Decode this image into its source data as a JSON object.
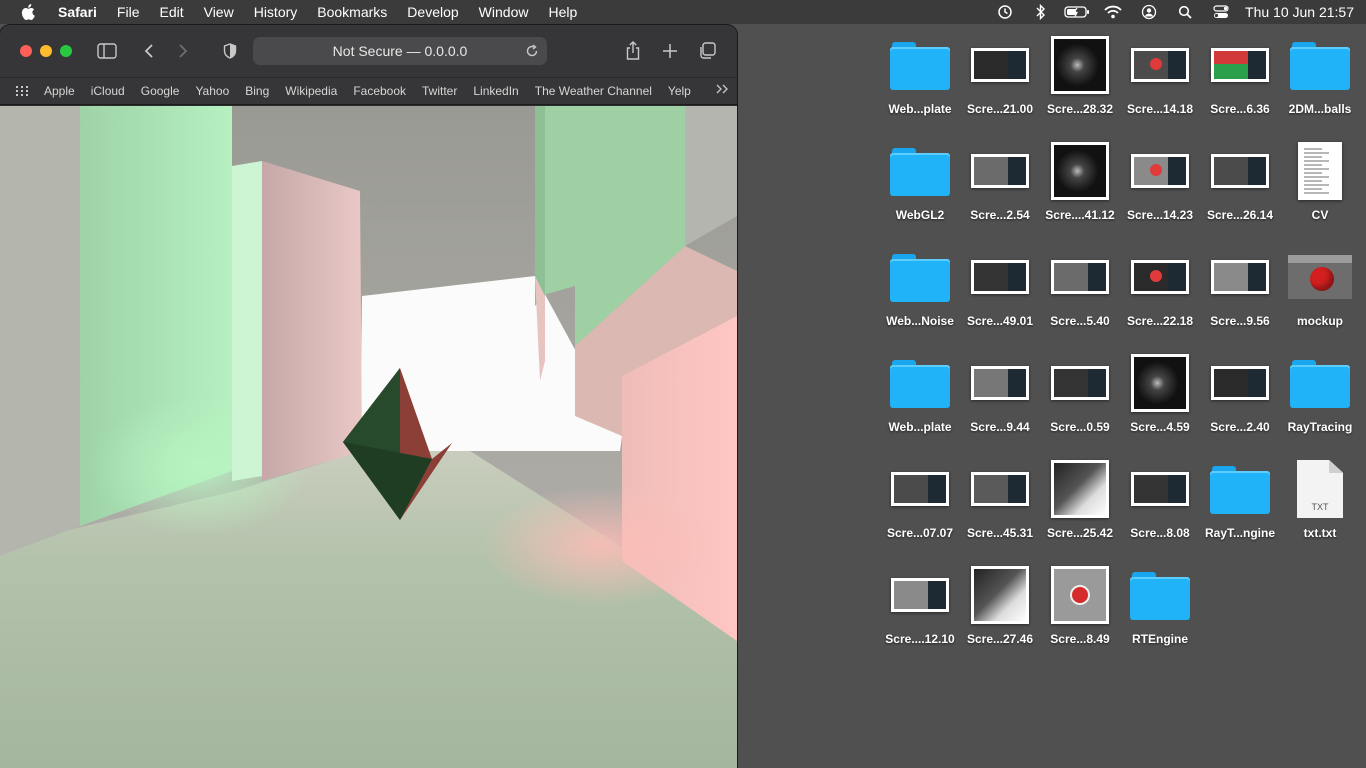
{
  "menubar": {
    "app_name": "Safari",
    "items": [
      "File",
      "Edit",
      "View",
      "History",
      "Bookmarks",
      "Develop",
      "Window",
      "Help"
    ],
    "clock": "Thu 10 Jun  21:57",
    "status_icons": [
      "time-machine-icon",
      "bluetooth-icon",
      "battery-icon",
      "wifi-icon",
      "user-icon",
      "search-icon",
      "control-center-icon"
    ]
  },
  "browser": {
    "address": "Not Secure — 0.0.0.0",
    "favorites": [
      "Apple",
      "iCloud",
      "Google",
      "Yahoo",
      "Bing",
      "Wikipedia",
      "Facebook",
      "Twitter",
      "LinkedIn",
      "The Weather Channel",
      "Yelp"
    ]
  },
  "desktop": {
    "icons": [
      {
        "label": "Web...plate",
        "kind": "folder"
      },
      {
        "label": "Scre...21.00",
        "kind": "screenshot"
      },
      {
        "label": "Scre...28.32",
        "kind": "screenshot"
      },
      {
        "label": "Scre...14.18",
        "kind": "screenshot"
      },
      {
        "label": "Scre...6.36",
        "kind": "screenshot"
      },
      {
        "label": "2DM...balls",
        "kind": "folder"
      },
      {
        "label": "WebGL2",
        "kind": "folder"
      },
      {
        "label": "Scre...2.54",
        "kind": "screenshot"
      },
      {
        "label": "Scre....41.12",
        "kind": "screenshot"
      },
      {
        "label": "Scre...14.23",
        "kind": "screenshot"
      },
      {
        "label": "Scre...26.14",
        "kind": "screenshot"
      },
      {
        "label": "CV",
        "kind": "document"
      },
      {
        "label": "Web...Noise",
        "kind": "folder"
      },
      {
        "label": "Scre...49.01",
        "kind": "screenshot"
      },
      {
        "label": "Scre...5.40",
        "kind": "screenshot"
      },
      {
        "label": "Scre...22.18",
        "kind": "screenshot"
      },
      {
        "label": "Scre...9.56",
        "kind": "screenshot"
      },
      {
        "label": "mockup",
        "kind": "image"
      },
      {
        "label": "Web...plate",
        "kind": "folder"
      },
      {
        "label": "Scre...9.44",
        "kind": "screenshot"
      },
      {
        "label": "Scre...0.59",
        "kind": "screenshot"
      },
      {
        "label": "Scre...4.59",
        "kind": "screenshot"
      },
      {
        "label": "Scre...2.40",
        "kind": "screenshot"
      },
      {
        "label": "RayTracing",
        "kind": "folder"
      },
      {
        "label": "Scre...07.07",
        "kind": "screenshot"
      },
      {
        "label": "Scre...45.31",
        "kind": "screenshot"
      },
      {
        "label": "Scre...25.42",
        "kind": "screenshot"
      },
      {
        "label": "Scre...8.08",
        "kind": "screenshot"
      },
      {
        "label": "RayT...ngine",
        "kind": "folder"
      },
      {
        "label": "txt.txt",
        "kind": "text-file",
        "ext": "TXT"
      },
      {
        "label": "Scre....12.10",
        "kind": "screenshot"
      },
      {
        "label": "Scre...27.46",
        "kind": "screenshot"
      },
      {
        "label": "Scre...8.49",
        "kind": "screenshot"
      },
      {
        "label": "RTEngine",
        "kind": "folder"
      }
    ]
  },
  "colors": {
    "folder": "#21b3f7",
    "menubar": "#3b3b3b",
    "desktop": "#505050",
    "scene_green": "#a8e6b4",
    "scene_red": "#f3b9b5",
    "octahedron": "#24452a"
  }
}
